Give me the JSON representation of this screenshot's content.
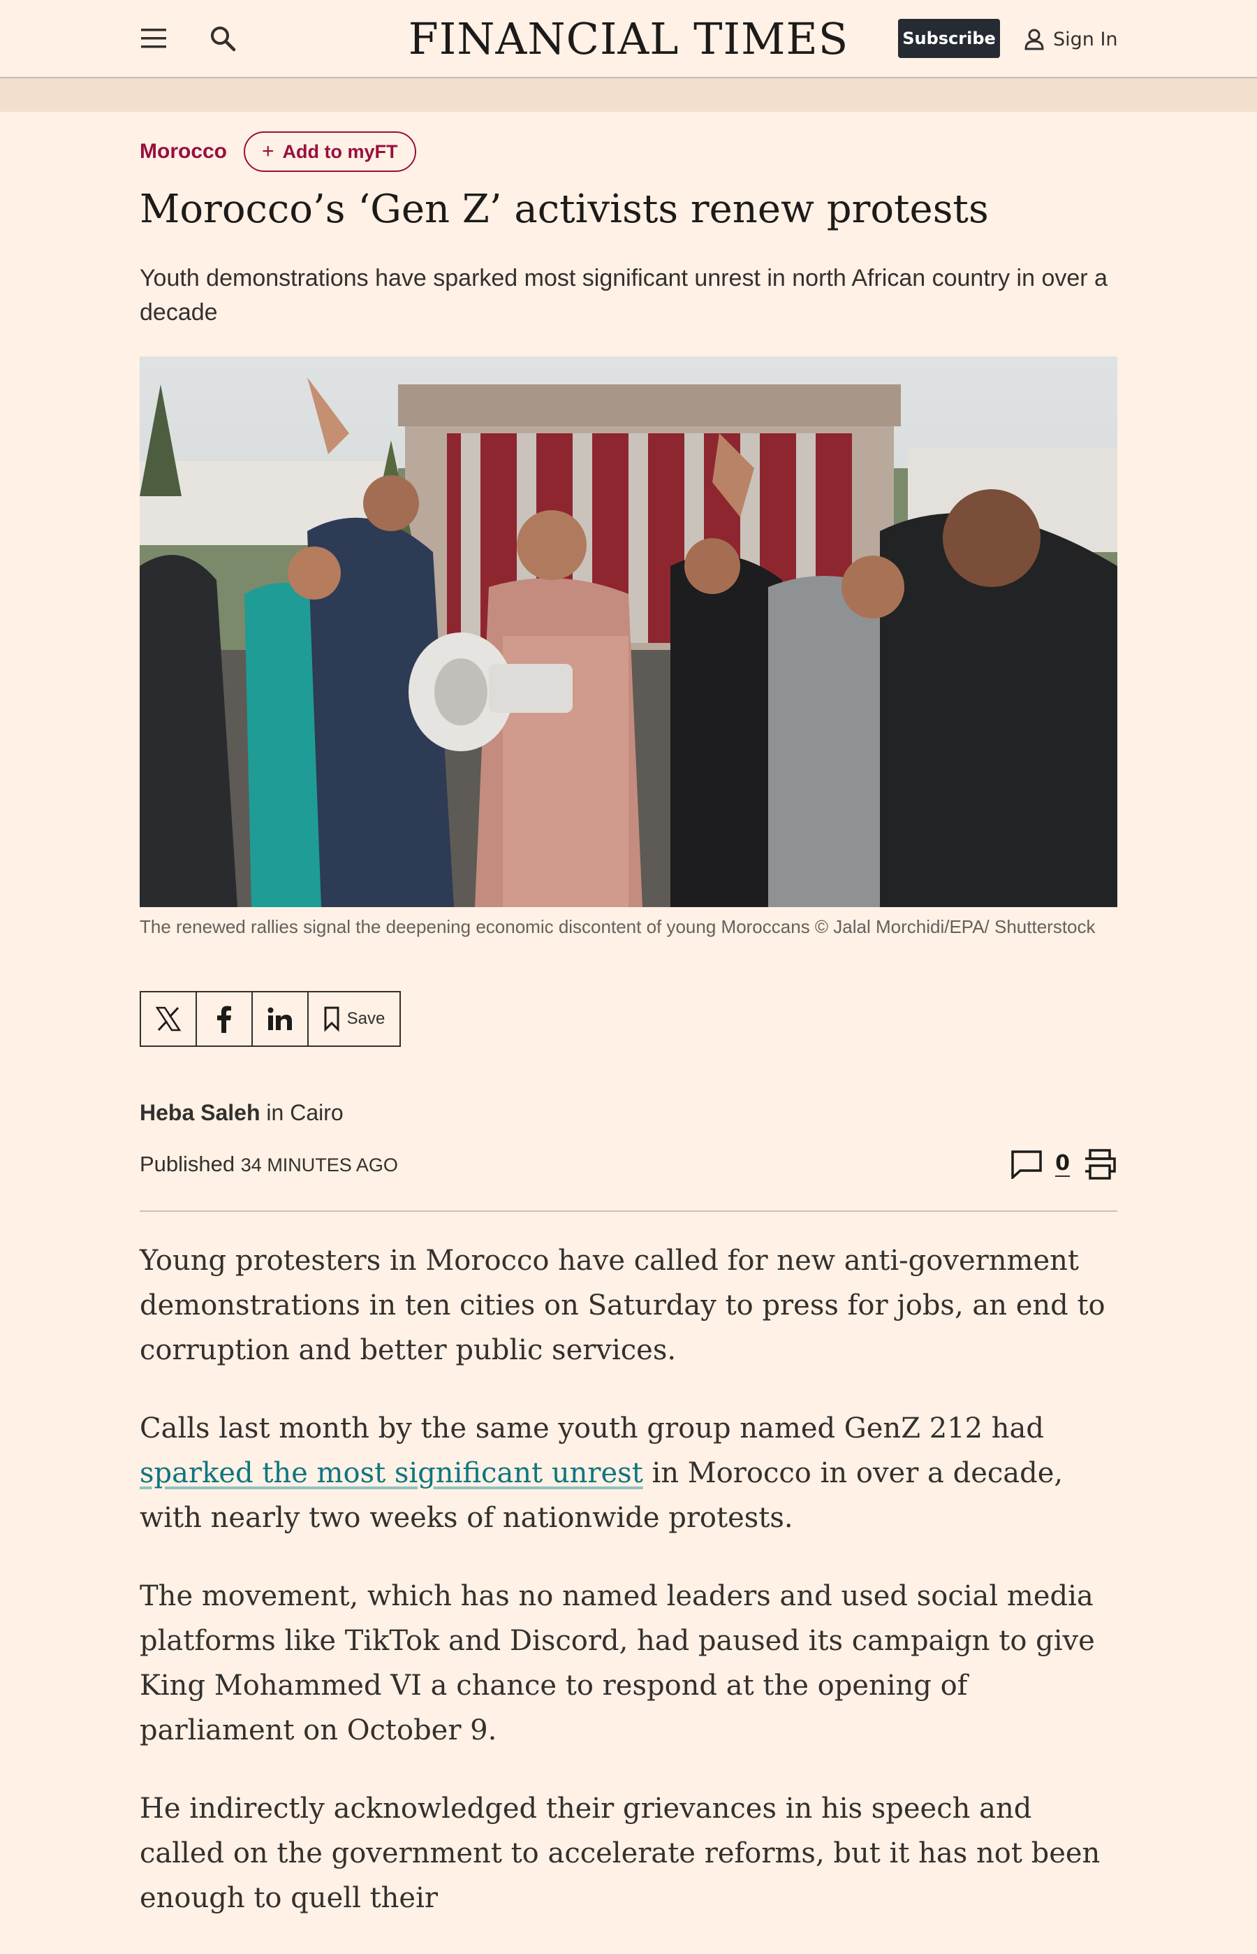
{
  "header": {
    "masthead": "FINANCIAL TIMES",
    "subscribe_label": "Subscribe",
    "signin_label": "Sign In"
  },
  "article": {
    "topic": "Morocco",
    "add_myft_label": "Add to myFT",
    "headline": "Morocco’s ‘Gen Z’ activists renew protests",
    "standfirst": "Youth demonstrations have sparked most significant unrest in north African country in over a decade",
    "caption": "The renewed rallies signal the deepening economic discontent of young Moroccans © Jalal Morchidi/EPA/ Shutterstock",
    "share": {
      "save_label": "Save"
    },
    "byline": {
      "author": "Heba Saleh",
      "location": " in Cairo"
    },
    "published": {
      "label": "Published",
      "time": "34 minutes ago"
    },
    "comment_count": "0",
    "paragraphs": {
      "p1": "Young protesters in Morocco have called for new anti-government demonstrations in ten cities on Saturday to press for jobs, an end to corruption and better public services.",
      "p2_before": "Calls last month by the same youth group named GenZ 212 had ",
      "p2_link": "sparked the most significant unrest",
      "p2_after": " in Morocco in over a decade, with nearly two weeks of nationwide protests.",
      "p3": "The movement, which has no named leaders and used social media platforms like TikTok and Discord, had paused its campaign to give King Mohammed VI a chance to respond at the opening of parliament on October 9.",
      "p4": "He indirectly acknowledged their grievances in his speech and called on the government to accelerate reforms, but it has not been enough to quell their"
    }
  },
  "colors": {
    "background": "#fff1e5",
    "claret": "#990f3d",
    "teal_link": "#0d7680",
    "dark_button": "#262a33"
  }
}
